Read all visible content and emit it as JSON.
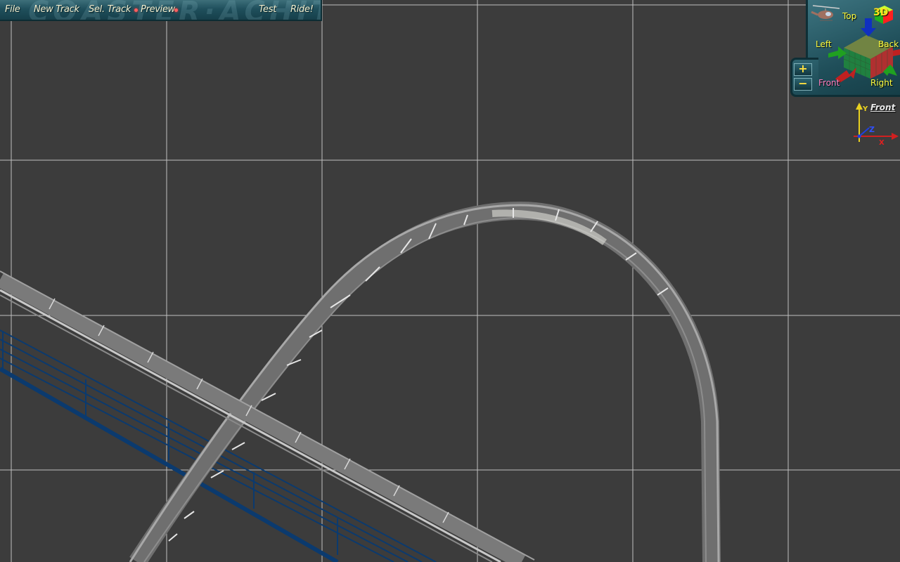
{
  "menu": {
    "watermark": "COASTER·ACHIT",
    "file": "File",
    "new_track": "New Track",
    "sel_track": "Sel. Track",
    "preview": "Preview",
    "test": "Test",
    "ride": "Ride!"
  },
  "view_panel": {
    "mode_3d": "3D",
    "top": "Top",
    "left": "Left",
    "back": "Back",
    "front": "Front",
    "right": "Right",
    "active_view": "Front",
    "zoom_in": "+",
    "zoom_out": "−"
  },
  "axis_indicator": {
    "view_name": "Front",
    "x": "X",
    "y": "Y",
    "z": "Z"
  },
  "colors": {
    "background": "#3c3c3c",
    "grid": "#d8d8d8",
    "track": "#7a7a7a",
    "support_structure": "#0b3a6e",
    "menu_accent": "#ff6060",
    "view_label": "#ffff40",
    "active_view_label": "#ff80c0"
  },
  "icons": {
    "helicopter": "helicopter-icon",
    "cube": "view-cube-icon",
    "axis": "axis-gizmo-icon"
  }
}
